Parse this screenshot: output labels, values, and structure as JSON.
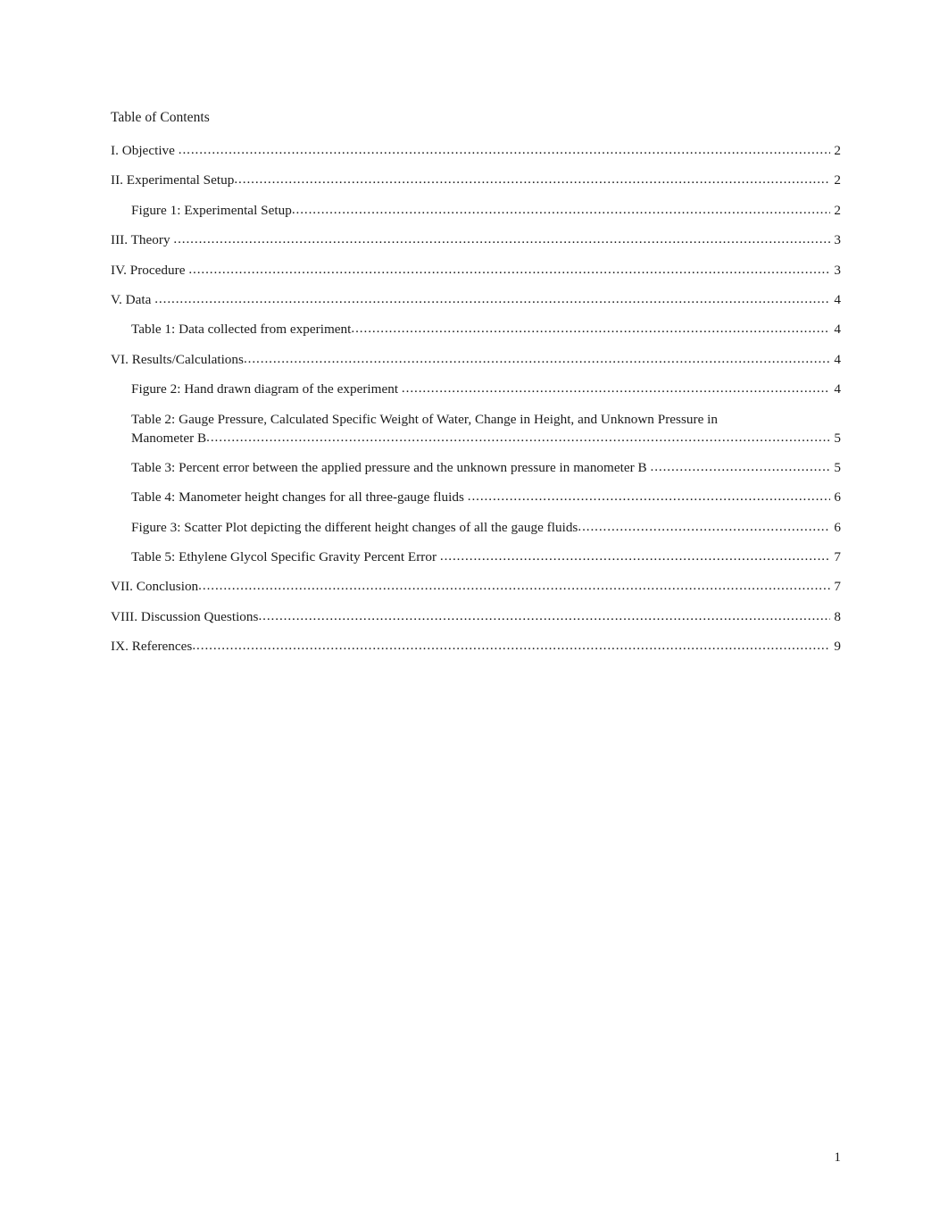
{
  "document": {
    "heading": "Table of Contents",
    "folio": "1"
  },
  "toc": {
    "entries": [
      {
        "level": 1,
        "title": "I. Objective ",
        "page": "2",
        "wrap": null
      },
      {
        "level": 1,
        "title": "II. Experimental Setup",
        "page": "2",
        "wrap": null
      },
      {
        "level": 2,
        "title": "Figure 1: Experimental Setup",
        "page": "2",
        "wrap": null
      },
      {
        "level": 1,
        "title": "III. Theory ",
        "page": "3",
        "wrap": null
      },
      {
        "level": 1,
        "title": "IV. Procedure ",
        "page": "3",
        "wrap": null
      },
      {
        "level": 1,
        "title": "V. Data ",
        "page": "4",
        "wrap": null
      },
      {
        "level": 2,
        "title": "Table 1: Data collected from experiment",
        "page": "4",
        "wrap": null
      },
      {
        "level": 1,
        "title": "VI. Results/Calculations",
        "page": "4",
        "wrap": null
      },
      {
        "level": 2,
        "title": "Figure 2: Hand drawn diagram of the experiment ",
        "page": "4",
        "wrap": null
      },
      {
        "level": 2,
        "title": "Manometer B",
        "page": "5",
        "wrap": "Table 2: Gauge Pressure, Calculated Specific Weight of Water, Change in Height, and Unknown Pressure in"
      },
      {
        "level": 2,
        "title": "Table 3: Percent error between the applied pressure and the unknown pressure in manometer B ",
        "page": "5",
        "wrap": null
      },
      {
        "level": 2,
        "title": "Table 4: Manometer height changes for all three-gauge fluids ",
        "page": "6",
        "wrap": null
      },
      {
        "level": 2,
        "title": "Figure 3: Scatter Plot depicting the different height changes of all the gauge fluids",
        "page": "6",
        "wrap": null
      },
      {
        "level": 2,
        "title": "Table 5: Ethylene Glycol Specific Gravity Percent Error ",
        "page": "7",
        "wrap": null
      },
      {
        "level": 1,
        "title": "VII. Conclusion",
        "page": "7",
        "wrap": null
      },
      {
        "level": 1,
        "title": "VIII. Discussion Questions",
        "page": "8",
        "wrap": null
      },
      {
        "level": 1,
        "title": "IX. References",
        "page": "9",
        "wrap": null
      }
    ]
  }
}
